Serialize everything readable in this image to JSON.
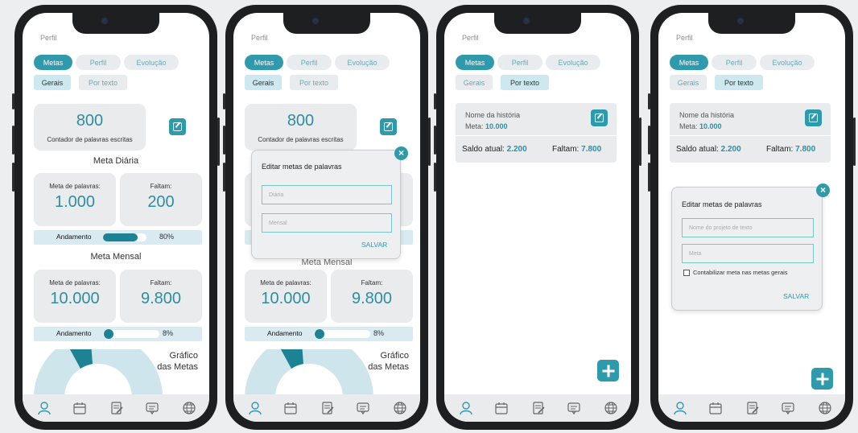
{
  "screen_title": "Perfil",
  "tabs": {
    "metas": "Metas",
    "perfil": "Perfil",
    "evolucao": "Evolução"
  },
  "subtabs": {
    "gerais": "Gerais",
    "por_texto": "Por texto"
  },
  "counter": {
    "value": "800",
    "label": "Contador de palavras escritas"
  },
  "daily": {
    "title": "Meta Diária",
    "goal_label": "Meta de palavras:",
    "goal_value": "1.000",
    "remaining_label": "Faltam:",
    "remaining_value": "200",
    "progress_label": "Andamento",
    "progress_pct": "80%",
    "progress": 0.8
  },
  "monthly": {
    "title": "Meta Mensal",
    "goal_label": "Meta de palavras:",
    "goal_value": "10.000",
    "remaining_label": "Faltam:",
    "remaining_value": "9.800",
    "progress_label": "Andamento",
    "progress_pct": "8%",
    "progress": 0.08
  },
  "chart_title_line1": "Gráfico",
  "chart_title_line2": "das Metas",
  "modal_general": {
    "title": "Editar metas de palavras",
    "field1_placeholder": "Diária",
    "field2_placeholder": "Mensal",
    "save": "SALVAR",
    "close": "×"
  },
  "story": {
    "name": "Nome da história",
    "meta_label": "Meta:",
    "meta_value": "10.000",
    "saldo_label": "Saldo atual:",
    "saldo_value": "2.200",
    "faltam_label": "Faltam:",
    "faltam_value": "7.800"
  },
  "modal_text": {
    "title": "Editar metas de palavras",
    "field1_placeholder": "Nome do projeto de texto",
    "field2_placeholder": "Meta",
    "checkbox_label": "Contabilizar meta nas metas gerais",
    "save": "SALVAR",
    "close": "×"
  },
  "nav_icons": [
    "user-icon",
    "calendar-icon",
    "document-edit-icon",
    "chat-icon",
    "globe-icon"
  ],
  "colors": {
    "accent": "#2e9aab",
    "value_text": "#2e8ea0",
    "progress_fill": "#1c8294",
    "card_bg": "#e9ebed"
  }
}
